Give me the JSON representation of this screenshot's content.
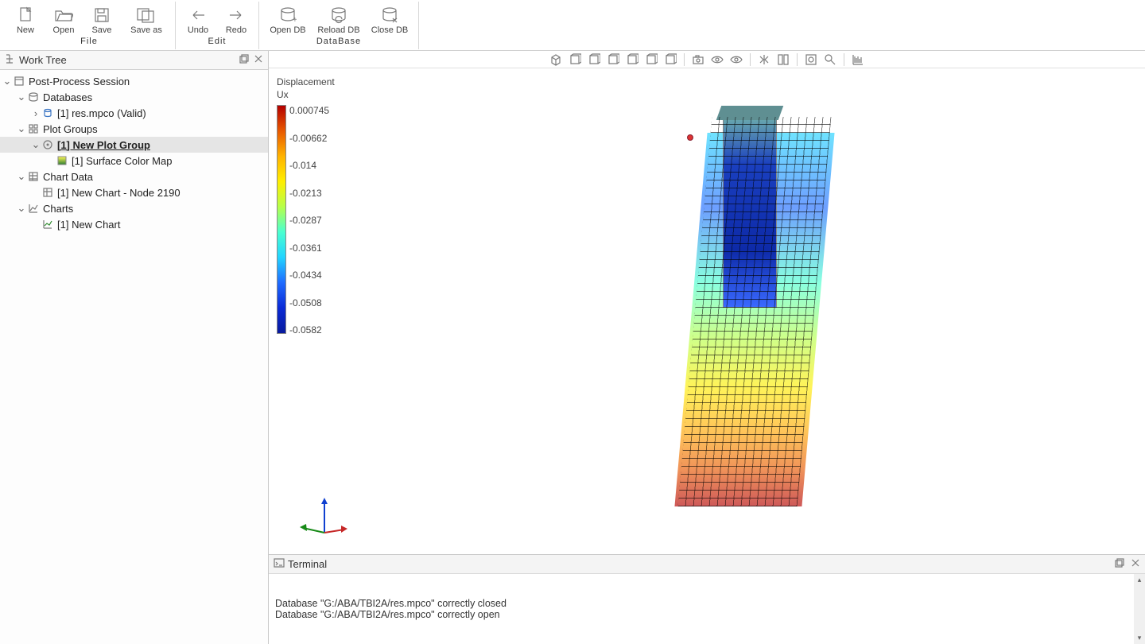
{
  "ribbon": {
    "groups": [
      {
        "label": "File",
        "buttons": [
          {
            "name": "new-button",
            "label": "New"
          },
          {
            "name": "open-button",
            "label": "Open"
          },
          {
            "name": "save-button",
            "label": "Save"
          },
          {
            "name": "save-as-button",
            "label": "Save as"
          }
        ]
      },
      {
        "label": "Edit",
        "buttons": [
          {
            "name": "undo-button",
            "label": "Undo"
          },
          {
            "name": "redo-button",
            "label": "Redo"
          }
        ]
      },
      {
        "label": "DataBase",
        "buttons": [
          {
            "name": "open-db-button",
            "label": "Open DB"
          },
          {
            "name": "reload-db-button",
            "label": "Reload DB"
          },
          {
            "name": "close-db-button",
            "label": "Close DB"
          }
        ]
      }
    ]
  },
  "work_tree": {
    "title": "Work Tree",
    "root": {
      "label": "Post-Process Session"
    },
    "databases": {
      "label": "Databases",
      "item": "[1] res.mpco (Valid)"
    },
    "plot_groups": {
      "label": "Plot Groups",
      "item": "[1] New Plot Group",
      "child": "[1] Surface Color Map"
    },
    "chart_data": {
      "label": "Chart Data",
      "item": "[1] New Chart - Node 2190"
    },
    "charts": {
      "label": "Charts",
      "item": "[1] New Chart"
    }
  },
  "view_toolbar": {
    "buttons": [
      "view-iso-icon",
      "view-front-icon",
      "view-back-icon",
      "view-left-icon",
      "view-right-icon",
      "view-top-icon",
      "view-bottom-icon",
      "sep",
      "camera-icon",
      "eye-open-icon",
      "eye-dash-icon",
      "sep",
      "mirror-icon",
      "split-icon",
      "sep",
      "zoom-fit-icon",
      "zoom-icon",
      "sep",
      "grid-icon"
    ]
  },
  "colorbar": {
    "title_line1": "Displacement",
    "title_line2": "Ux",
    "ticks": [
      "0.000745",
      "-0.00662",
      "-0.014",
      "-0.0213",
      "-0.0287",
      "-0.0361",
      "-0.0434",
      "-0.0508",
      "-0.0582"
    ]
  },
  "terminal": {
    "title": "Terminal",
    "lines": [
      "Database \"G:/ABA/TBI2A/res.mpco\" correctly closed",
      "Database \"G:/ABA/TBI2A/res.mpco\" correctly open"
    ]
  },
  "chart_data": {
    "type": "colorbar",
    "title": "Displacement Ux",
    "range": [
      -0.0582,
      0.000745
    ],
    "ticks": [
      0.000745,
      -0.00662,
      -0.014,
      -0.0213,
      -0.0287,
      -0.0361,
      -0.0434,
      -0.0508,
      -0.0582
    ],
    "colormap": "jet-reversed"
  }
}
